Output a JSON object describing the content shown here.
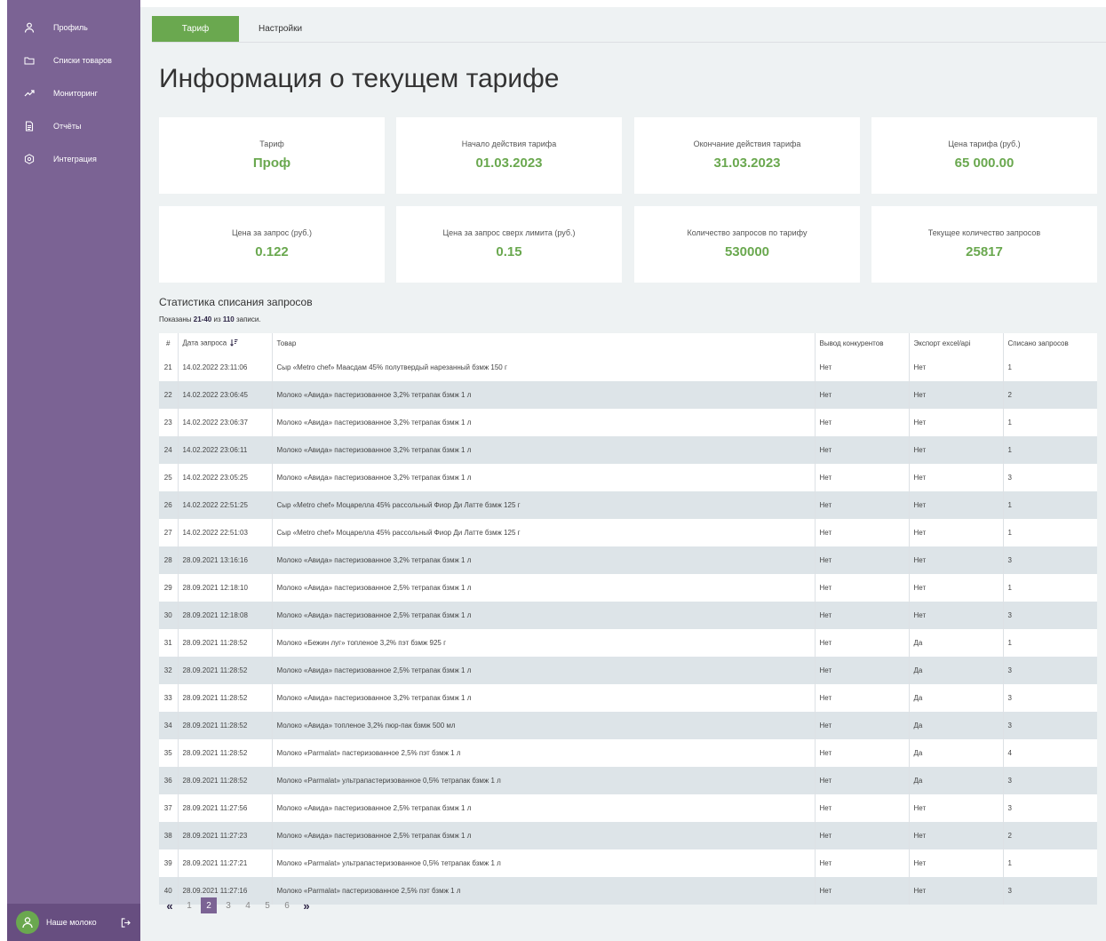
{
  "sidebar": {
    "items": [
      {
        "label": "Профиль",
        "icon": "user-icon"
      },
      {
        "label": "Списки товаров",
        "icon": "folder-icon"
      },
      {
        "label": "Мониторинг",
        "icon": "trending-up-icon"
      },
      {
        "label": "Отчёты",
        "icon": "document-icon"
      },
      {
        "label": "Интеграция",
        "icon": "api-icon"
      }
    ],
    "user_name": "Наше молоко"
  },
  "tabs": [
    {
      "label": "Тариф",
      "active": true
    },
    {
      "label": "Настройки",
      "active": false
    }
  ],
  "page_title": "Информация о текущем тарифе",
  "cards": [
    {
      "label": "Тариф",
      "value": "Проф"
    },
    {
      "label": "Начало действия тарифа",
      "value": "01.03.2023"
    },
    {
      "label": "Окончание действия тарифа",
      "value": "31.03.2023"
    },
    {
      "label": "Цена тарифа (руб.)",
      "value": "65 000.00"
    },
    {
      "label": "Цена за запрос (руб.)",
      "value": "0.122"
    },
    {
      "label": "Цена за запрос сверх лимита (руб.)",
      "value": "0.15"
    },
    {
      "label": "Количество запросов по тарифу",
      "value": "530000"
    },
    {
      "label": "Текущее количество запросов",
      "value": "25817"
    }
  ],
  "stats": {
    "title": "Статистика списания запросов",
    "summary_prefix": "Показаны",
    "summary_range": "21-40",
    "summary_mid": "из",
    "summary_total": "110",
    "summary_suffix": "записи."
  },
  "table": {
    "headers": [
      "#",
      "Дата запроса",
      "Товар",
      "Вывод конкурентов",
      "Экспорт excel/api",
      "Списано запросов"
    ],
    "rows": [
      [
        "21",
        "14.02.2022 23:11:06",
        "Сыр «Metro chef» Маасдам 45% полутвердый нарезанный бзмж 150 г",
        "Нет",
        "Нет",
        "1"
      ],
      [
        "22",
        "14.02.2022 23:06:45",
        "Молоко «Авида» пастеризованное 3,2% тетрапак бзмж 1 л",
        "Нет",
        "Нет",
        "2"
      ],
      [
        "23",
        "14.02.2022 23:06:37",
        "Молоко «Авида» пастеризованное 3,2% тетрапак бзмж 1 л",
        "Нет",
        "Нет",
        "1"
      ],
      [
        "24",
        "14.02.2022 23:06:11",
        "Молоко «Авида» пастеризованное 3,2% тетрапак бзмж 1 л",
        "Нет",
        "Нет",
        "1"
      ],
      [
        "25",
        "14.02.2022 23:05:25",
        "Молоко «Авида» пастеризованное 3,2% тетрапак бзмж 1 л",
        "Нет",
        "Нет",
        "3"
      ],
      [
        "26",
        "14.02.2022 22:51:25",
        "Сыр «Metro chef» Моцарелла 45% рассольный Фиор Ди Латте бзмж 125 г",
        "Нет",
        "Нет",
        "1"
      ],
      [
        "27",
        "14.02.2022 22:51:03",
        "Сыр «Metro chef» Моцарелла 45% рассольный Фиор Ди Латте бзмж 125 г",
        "Нет",
        "Нет",
        "1"
      ],
      [
        "28",
        "28.09.2021 13:16:16",
        "Молоко «Авида» пастеризованное 3,2% тетрапак бзмж 1 л",
        "Нет",
        "Нет",
        "3"
      ],
      [
        "29",
        "28.09.2021 12:18:10",
        "Молоко «Авида» пастеризованное 2,5% тетрапак бзмж 1 л",
        "Нет",
        "Нет",
        "1"
      ],
      [
        "30",
        "28.09.2021 12:18:08",
        "Молоко «Авида» пастеризованное 2,5% тетрапак бзмж 1 л",
        "Нет",
        "Нет",
        "3"
      ],
      [
        "31",
        "28.09.2021 11:28:52",
        "Молоко «Бежин луг» топленое 3,2% пэт бзмж 925 г",
        "Нет",
        "Да",
        "1"
      ],
      [
        "32",
        "28.09.2021 11:28:52",
        "Молоко «Авида» пастеризованное 2,5% тетрапак бзмж 1 л",
        "Нет",
        "Да",
        "3"
      ],
      [
        "33",
        "28.09.2021 11:28:52",
        "Молоко «Авида» пастеризованное 3,2% тетрапак бзмж 1 л",
        "Нет",
        "Да",
        "3"
      ],
      [
        "34",
        "28.09.2021 11:28:52",
        "Молоко «Авида» топленое 3,2% пюр-пак бзмж 500 мл",
        "Нет",
        "Да",
        "3"
      ],
      [
        "35",
        "28.09.2021 11:28:52",
        "Молоко «Parmalat» пастеризованное 2,5% пэт бзмж 1 л",
        "Нет",
        "Да",
        "4"
      ],
      [
        "36",
        "28.09.2021 11:28:52",
        "Молоко «Parmalat» ультрапастеризованное 0,5% тетрапак бзмж 1 л",
        "Нет",
        "Да",
        "3"
      ],
      [
        "37",
        "28.09.2021 11:27:56",
        "Молоко «Авида» пастеризованное 2,5% тетрапак бзмж 1 л",
        "Нет",
        "Нет",
        "3"
      ],
      [
        "38",
        "28.09.2021 11:27:23",
        "Молоко «Авида» пастеризованное 2,5% тетрапак бзмж 1 л",
        "Нет",
        "Нет",
        "2"
      ],
      [
        "39",
        "28.09.2021 11:27:21",
        "Молоко «Parmalat» ультрапастеризованное 0,5% тетрапак бзмж 1 л",
        "Нет",
        "Нет",
        "1"
      ],
      [
        "40",
        "28.09.2021 11:27:16",
        "Молоко «Parmalat» пастеризованное 2,5% пэт бзмж 1 л",
        "Нет",
        "Нет",
        "3"
      ]
    ]
  },
  "pagination": {
    "first": "«",
    "last": "»",
    "pages": [
      "1",
      "2",
      "3",
      "4",
      "5",
      "6"
    ],
    "current": "2"
  },
  "colors": {
    "sidebar": "#7b6394",
    "accent_green": "#6aa84f",
    "row_stripe": "#dde4e8",
    "background": "#eef2f3"
  }
}
